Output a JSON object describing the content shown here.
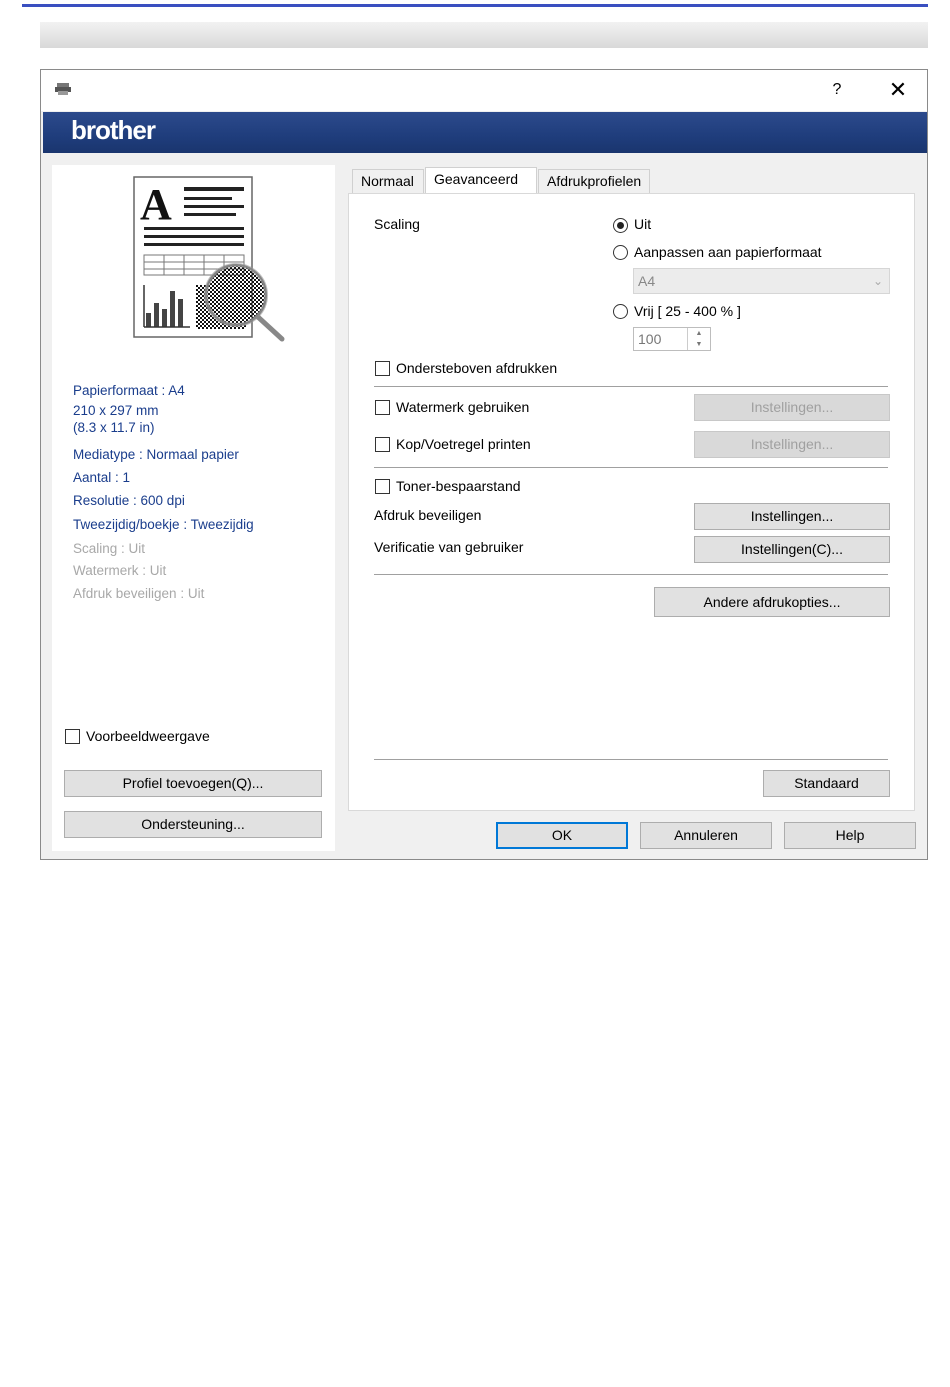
{
  "titlebar": {
    "help": "?",
    "close": "✕"
  },
  "brand": {
    "logo": "brother"
  },
  "left_panel": {
    "info": [
      {
        "text": "Papierformaat : A4",
        "dim": false
      },
      {
        "text": "210 x 297 mm",
        "dim": false
      },
      {
        "text": "(8.3 x 11.7 in)",
        "dim": false
      },
      {
        "text": "Mediatype : Normaal papier",
        "dim": false
      },
      {
        "text": "Aantal : 1",
        "dim": false
      },
      {
        "text": "Resolutie : 600 dpi",
        "dim": false
      },
      {
        "text": "Tweezijdig/boekje : Tweezijdig",
        "dim": false
      },
      {
        "text": "Scaling : Uit",
        "dim": true
      },
      {
        "text": "Watermerk : Uit",
        "dim": true
      },
      {
        "text": "Afdruk beveiligen : Uit",
        "dim": true
      }
    ],
    "preview_label": "Voorbeeldweergave",
    "add_profile": "Profiel toevoegen(Q)...",
    "support": "Ondersteuning..."
  },
  "tabs": [
    "Normaal",
    "Geavanceerd",
    "Afdrukprofielen"
  ],
  "advanced": {
    "scaling_label": "Scaling",
    "scaling_off": "Uit",
    "scaling_fit": "Aanpassen aan papierformaat",
    "paper_select": "A4",
    "scaling_free": "Vrij [ 25 - 400 % ]",
    "free_value": "100",
    "upside_down": "Ondersteboven afdrukken",
    "watermark": "Watermerk gebruiken",
    "watermark_settings": "Instellingen...",
    "header_footer": "Kop/Voetregel printen",
    "header_footer_settings": "Instellingen...",
    "toner_save": "Toner-bespaarstand",
    "secure_print": "Afdruk beveiligen",
    "secure_print_settings": "Instellingen...",
    "user_verification": "Verificatie van gebruiker",
    "user_verification_settings": "Instellingen(C)...",
    "other_options": "Andere afdrukopties...",
    "default": "Standaard"
  },
  "footer": {
    "ok": "OK",
    "cancel": "Annuleren",
    "help": "Help"
  },
  "colors": {
    "brand": "#1f3d7c",
    "info_text": "#1a3d8c",
    "accent": "#0078d7"
  }
}
